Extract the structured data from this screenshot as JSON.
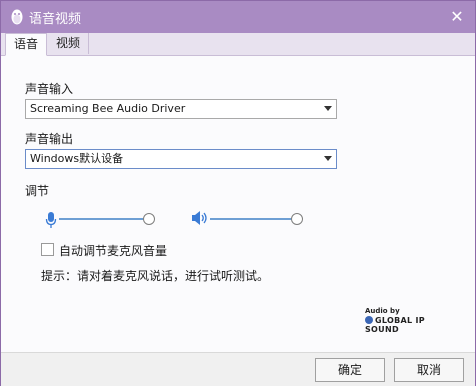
{
  "window": {
    "title": "语音视频",
    "close_icon": "✕"
  },
  "tabs": [
    {
      "label": "语音"
    },
    {
      "label": "视频"
    }
  ],
  "input": {
    "label": "声音输入",
    "selected": "Screaming Bee Audio Driver"
  },
  "output": {
    "label": "声音输出",
    "selected": "Windows默认设备"
  },
  "adjust": {
    "label": "调节",
    "mic_level": 1.0,
    "speaker_level": 1.0,
    "auto_adjust_label": "自动调节麦克风音量",
    "auto_adjust_checked": false
  },
  "hint": "提示：请对着麦克风说话，进行试听测试。",
  "logo": {
    "line1": "Audio by",
    "line2": "GLOBAL IP SOUND"
  },
  "buttons": {
    "ok": "确定",
    "cancel": "取消"
  },
  "colors": {
    "titlebar": "#a98bc3",
    "track": "#6e9fd4"
  }
}
